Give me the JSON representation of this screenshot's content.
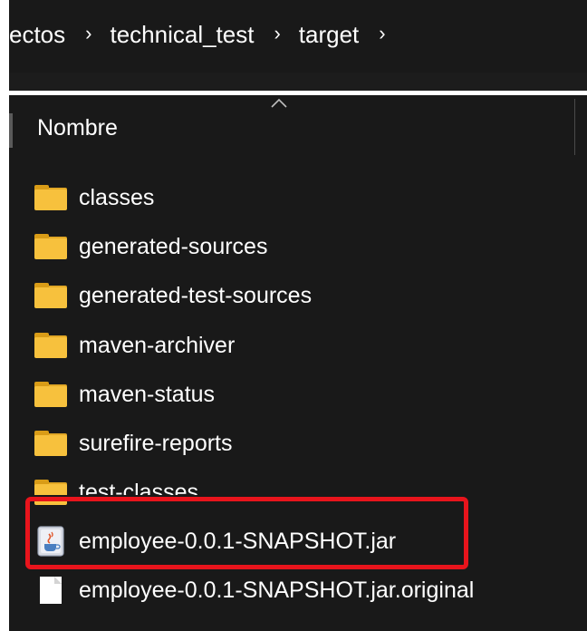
{
  "breadcrumb": {
    "items": [
      "ectos",
      "technical_test",
      "target"
    ],
    "separator": "›"
  },
  "list": {
    "column_header": "Nombre",
    "folders": [
      {
        "name": "classes"
      },
      {
        "name": "generated-sources"
      },
      {
        "name": "generated-test-sources"
      },
      {
        "name": "maven-archiver"
      },
      {
        "name": "maven-status"
      },
      {
        "name": "surefire-reports"
      },
      {
        "name": "test-classes"
      }
    ],
    "files": [
      {
        "name": "employee-0.0.1-SNAPSHOT.jar",
        "icon": "java-jar-icon",
        "highlighted": true
      },
      {
        "name": "employee-0.0.1-SNAPSHOT.jar.original",
        "icon": "blank-file-icon",
        "highlighted": false
      }
    ]
  },
  "colors": {
    "background": "#191919",
    "folder": "#f7c13d",
    "highlight": "#e8141c",
    "text": "#ffffff"
  }
}
